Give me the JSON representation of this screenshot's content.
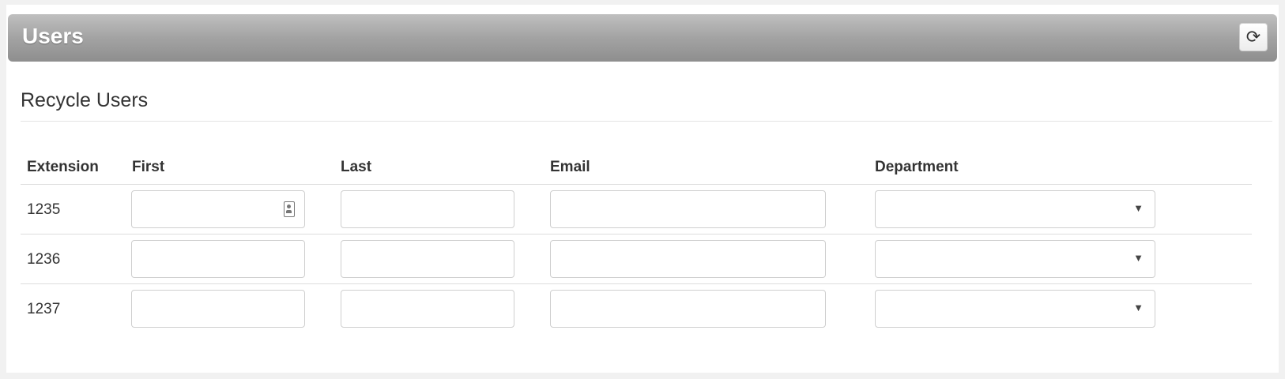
{
  "panel": {
    "title": "Users",
    "refresh_icon": "refresh-icon"
  },
  "section": {
    "title": "Recycle Users"
  },
  "table": {
    "headers": [
      "Extension",
      "First",
      "Last",
      "Email",
      "Department"
    ],
    "rows": [
      {
        "extension": "1235",
        "first": "",
        "last": "",
        "email": "",
        "department": ""
      },
      {
        "extension": "1236",
        "first": "",
        "last": "",
        "email": "",
        "department": ""
      },
      {
        "extension": "1237",
        "first": "",
        "last": "",
        "email": "",
        "department": ""
      }
    ],
    "first_field_icon": "contact-card-icon",
    "select_caret": "▼"
  }
}
